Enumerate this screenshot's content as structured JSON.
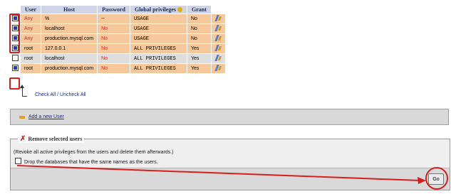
{
  "table": {
    "headers": [
      "User",
      "Host",
      "Password",
      "Global privileges",
      "Grant"
    ],
    "rows": [
      {
        "user": "Any",
        "host": "%",
        "password": "--",
        "privileges": "USAGE",
        "grant": "No",
        "checked": true
      },
      {
        "user": "Any",
        "host": "localhost",
        "password": "No",
        "privileges": "USAGE",
        "grant": "No",
        "checked": true
      },
      {
        "user": "Any",
        "host": "production.mysql.com",
        "password": "No",
        "privileges": "USAGE",
        "grant": "No",
        "checked": true
      },
      {
        "user": "root",
        "host": "127.0.0.1",
        "password": "No",
        "privileges": "ALL PRIVILEGES",
        "grant": "Yes",
        "checked": true
      },
      {
        "user": "root",
        "host": "localhost",
        "password": "No",
        "privileges": "ALL PRIVILEGES",
        "grant": "Yes",
        "checked": false
      },
      {
        "user": "root",
        "host": "production.mysql.com",
        "password": "No",
        "privileges": "ALL PRIVILEGES",
        "grant": "Yes",
        "checked": true
      }
    ]
  },
  "check_all": {
    "check_label": "Check All",
    "separator": " / ",
    "uncheck_label": "Uncheck All"
  },
  "add_user": {
    "label": "Add a new User"
  },
  "remove": {
    "legend": "Remove selected users",
    "description": "(Revoke all active privileges from the users and delete them afterwards.)",
    "drop_db_label": "Drop the databases that have the same names as the users.",
    "go_label": "Go"
  },
  "colors": {
    "highlight": "#d42020",
    "selected_row": "#f6c89b",
    "unselected_row": "#dedede"
  },
  "icons": {
    "edit": "edit-privileges-icon",
    "add_user": "add-user-icon",
    "remove": "remove-x-icon",
    "help": "help-icon"
  }
}
